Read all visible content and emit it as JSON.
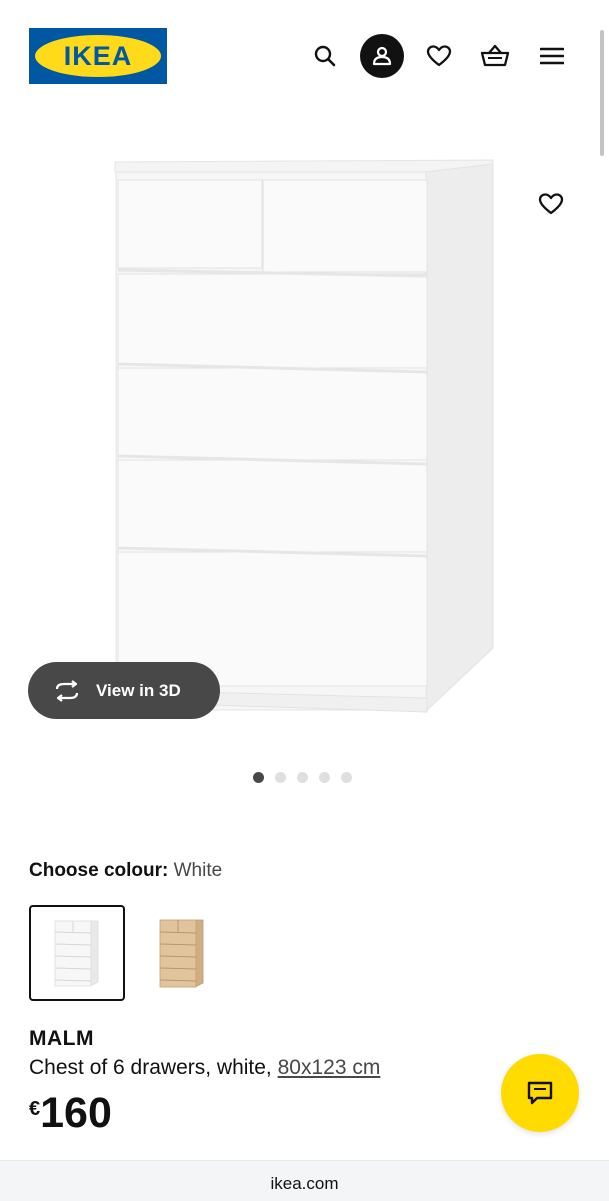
{
  "header": {
    "logo_text": "IKEA",
    "icons": [
      "search-icon",
      "account-icon",
      "heart-icon",
      "basket-icon",
      "menu-icon"
    ]
  },
  "gallery": {
    "view_3d_label": "View in 3D",
    "slide_count": 5,
    "active_slide": 1
  },
  "colour": {
    "label": "Choose colour:",
    "value": "White",
    "options": [
      "White",
      "White stained oak veneer"
    ]
  },
  "product": {
    "name": "MALM",
    "description": "Chest of 6 drawers, white,",
    "size_link": "80x123 cm",
    "currency": "€",
    "price": "160"
  },
  "browser": {
    "url": "ikea.com"
  },
  "colors": {
    "brand_blue": "#0058a3",
    "brand_yellow": "#ffda1a",
    "chat_yellow": "#ffdb00",
    "pill_dark": "#484848"
  }
}
